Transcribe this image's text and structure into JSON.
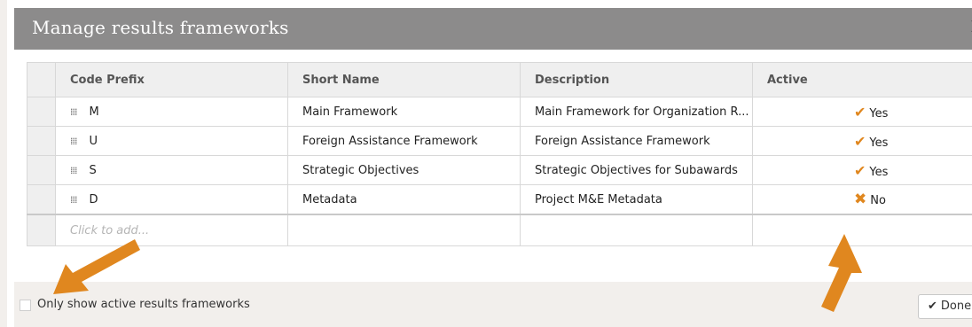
{
  "dialog": {
    "title": "Manage results frameworks",
    "close_symbol": "✕"
  },
  "table": {
    "columns": [
      "Code Prefix",
      "Short Name",
      "Description",
      "Active"
    ],
    "rows": [
      {
        "code": "M",
        "short_name": "Main Framework",
        "description": "Main Framework for Organization R...",
        "active": "Yes",
        "active_icon": "check-icon"
      },
      {
        "code": "U",
        "short_name": "Foreign Assistance Framework",
        "description": "Foreign Assistance Framework",
        "active": "Yes",
        "active_icon": "check-icon"
      },
      {
        "code": "S",
        "short_name": "Strategic Objectives",
        "description": "Strategic Objectives for Subawards",
        "active": "Yes",
        "active_icon": "check-icon"
      },
      {
        "code": "D",
        "short_name": "Metadata",
        "description": "Project M&E Metadata",
        "active": "No",
        "active_icon": "x-icon"
      }
    ],
    "new_row_placeholder": "Click to add..."
  },
  "footer": {
    "filter_label": "Only show active results frameworks",
    "filter_checked": false,
    "done_label": "Done",
    "done_icon": "check-icon"
  },
  "annotations": {
    "arrow_color": "#e0871f",
    "arrow_icon": "arrow-icon"
  }
}
